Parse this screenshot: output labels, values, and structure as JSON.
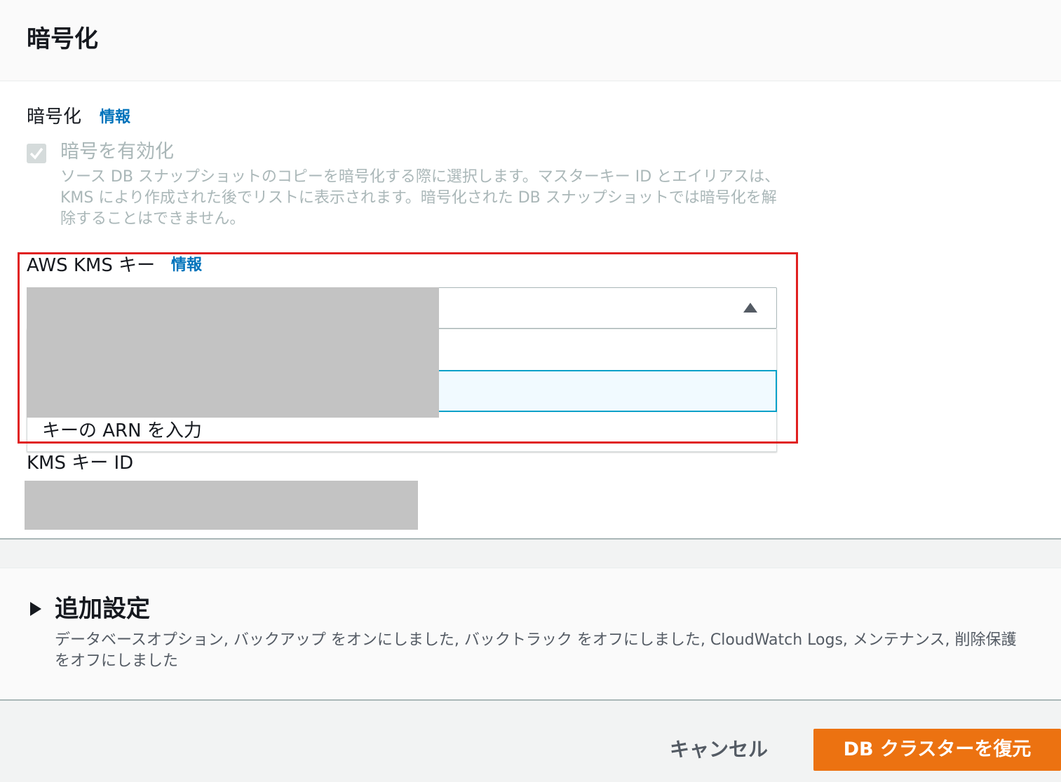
{
  "encryption_panel": {
    "title": "暗号化",
    "field_label": "暗号化",
    "info_link": "情報",
    "checkbox": {
      "label": "暗号を有効化",
      "checked": true,
      "disabled": true,
      "description": "ソース DB スナップショットのコピーを暗号化する際に選択します。マスターキー ID とエイリアスは、KMS により作成された後でリストに表示されます。暗号化された DB スナップショットでは暗号化を解除することはできません。"
    },
    "kms_key": {
      "label": "AWS KMS キー",
      "info_link": "情報",
      "dropdown_expanded": true,
      "options": [
        "キーの ARN を入力"
      ]
    },
    "kms_key_id": {
      "label": "KMS キー ID"
    }
  },
  "additional_settings": {
    "title": "追加設定",
    "description": "データベースオプション, バックアップ をオンにしました, バックトラック をオフにしました, CloudWatch Logs, メンテナンス, 削除保護 をオフにしました"
  },
  "footer": {
    "cancel_label": "キャンセル",
    "submit_label": "DB クラスターを復元"
  },
  "colors": {
    "accent_orange": "#ec7211",
    "link_blue": "#0073bb",
    "highlight_border": "#00a1c9",
    "annotation_red": "#e02020"
  }
}
